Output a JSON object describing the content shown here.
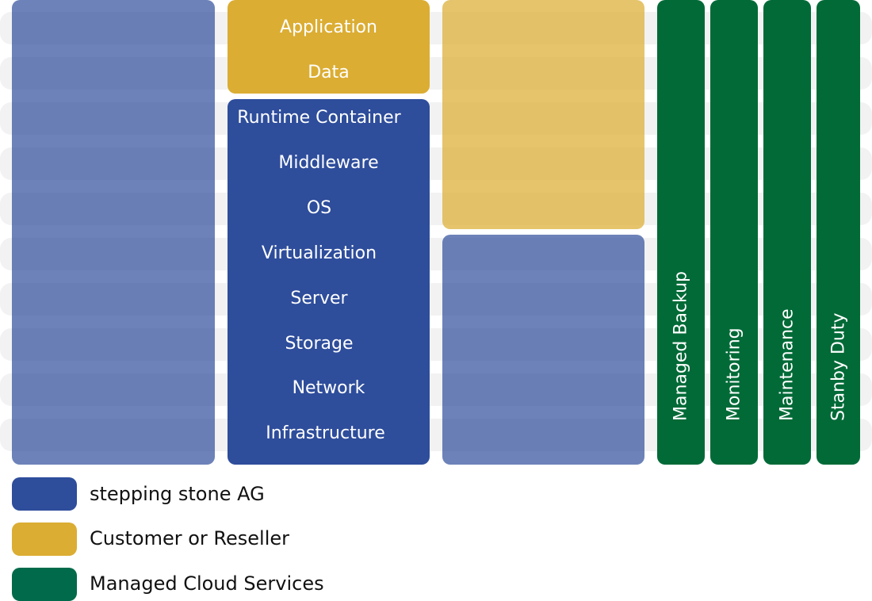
{
  "colors": {
    "stepping_stone": "#2e4d9b",
    "customer": "#dbad33",
    "managed_services": "#016a37",
    "stripe": "#f2f2f2"
  },
  "customer_layers": [
    "Application",
    "Data"
  ],
  "provider_layers": [
    "Runtime Container",
    "Middleware",
    "OS",
    "Virtualization",
    "Server",
    "Storage",
    "Network",
    "Infrastructure"
  ],
  "services": [
    "Managed Backup",
    "Monitoring",
    "Maintenance",
    "Stanby Duty"
  ],
  "legend": [
    {
      "label": "stepping stone AG",
      "color": "#2e4d9b"
    },
    {
      "label": "Customer or Reseller",
      "color": "#dbad33"
    },
    {
      "label": "Managed Cloud Services",
      "color": "#016a37"
    }
  ]
}
